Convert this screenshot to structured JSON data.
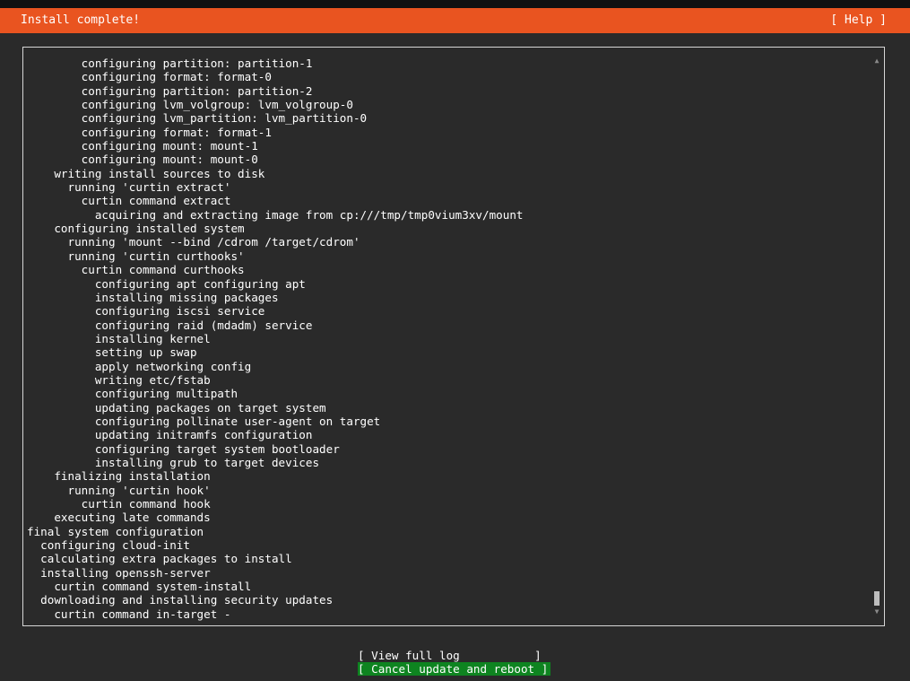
{
  "header": {
    "title": "Install complete!",
    "help_label": "[ Help ]"
  },
  "colors": {
    "header_bg": "#e95420",
    "background": "#2a2a2a",
    "selected_button_bg": "#0e8420",
    "text": "#ffffff"
  },
  "log_lines": [
    "        configuring partition: partition-1",
    "        configuring format: format-0",
    "        configuring partition: partition-2",
    "        configuring lvm_volgroup: lvm_volgroup-0",
    "        configuring lvm_partition: lvm_partition-0",
    "        configuring format: format-1",
    "        configuring mount: mount-1",
    "        configuring mount: mount-0",
    "    writing install sources to disk",
    "      running 'curtin extract'",
    "        curtin command extract",
    "          acquiring and extracting image from cp:///tmp/tmp0vium3xv/mount",
    "    configuring installed system",
    "      running 'mount --bind /cdrom /target/cdrom'",
    "      running 'curtin curthooks'",
    "        curtin command curthooks",
    "          configuring apt configuring apt",
    "          installing missing packages",
    "          configuring iscsi service",
    "          configuring raid (mdadm) service",
    "          installing kernel",
    "          setting up swap",
    "          apply networking config",
    "          writing etc/fstab",
    "          configuring multipath",
    "          updating packages on target system",
    "          configuring pollinate user-agent on target",
    "          updating initramfs configuration",
    "          configuring target system bootloader",
    "          installing grub to target devices",
    "    finalizing installation",
    "      running 'curtin hook'",
    "        curtin command hook",
    "    executing late commands",
    "final system configuration",
    "  configuring cloud-init",
    "  calculating extra packages to install",
    "  installing openssh-server",
    "    curtin command system-install",
    "  downloading and installing security updates",
    "    curtin command in-target -"
  ],
  "scrollbar": {
    "up_glyph": "▲",
    "down_glyph": "▼",
    "position": 0.96
  },
  "buttons": {
    "view_log": "[ View full log           ]",
    "cancel_reboot": "[ Cancel update and reboot ]"
  }
}
